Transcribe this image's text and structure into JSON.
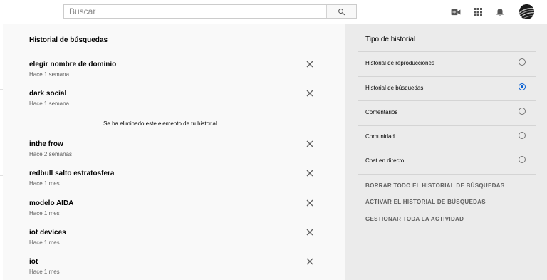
{
  "header": {
    "search_placeholder": "Buscar",
    "icons": [
      "search-icon",
      "video-camera-icon",
      "apps-grid-icon",
      "bell-icon",
      "avatar"
    ]
  },
  "main": {
    "title": "Historial de búsquedas",
    "entries": [
      {
        "query": "elegir nombre de dominio",
        "time": "Hace 1 semana"
      },
      {
        "query": "dark social",
        "time": "Hace 1 semana"
      },
      {
        "query": "inthe frow",
        "time": "Hace 2 semanas"
      },
      {
        "query": "redbull salto estratosfera",
        "time": "Hace 1 mes"
      },
      {
        "query": "modelo AIDA",
        "time": "Hace 1 mes"
      },
      {
        "query": "iot devices",
        "time": "Hace 1 mes"
      },
      {
        "query": "iot",
        "time": "Hace 1 mes"
      }
    ],
    "removed_notice": "Se ha eliminado este elemento de tu historial."
  },
  "sidebar": {
    "title": "Tipo de historial",
    "options": [
      {
        "label": "Historial de reproducciones",
        "selected": false
      },
      {
        "label": "Historial de búsquedas",
        "selected": true
      },
      {
        "label": "Comentarios",
        "selected": false
      },
      {
        "label": "Comunidad",
        "selected": false
      },
      {
        "label": "Chat en directo",
        "selected": false
      }
    ],
    "actions": [
      "BORRAR TODO EL HISTORIAL DE BÚSQUEDAS",
      "ACTIVAR EL HISTORIAL DE BÚSQUEDAS",
      "GESTIONAR TODA LA ACTIVIDAD"
    ]
  },
  "colors": {
    "accent": "#065fd4",
    "main_bg": "#f9f9f9",
    "side_bg": "#ebebeb",
    "secondary_text": "#606060"
  }
}
